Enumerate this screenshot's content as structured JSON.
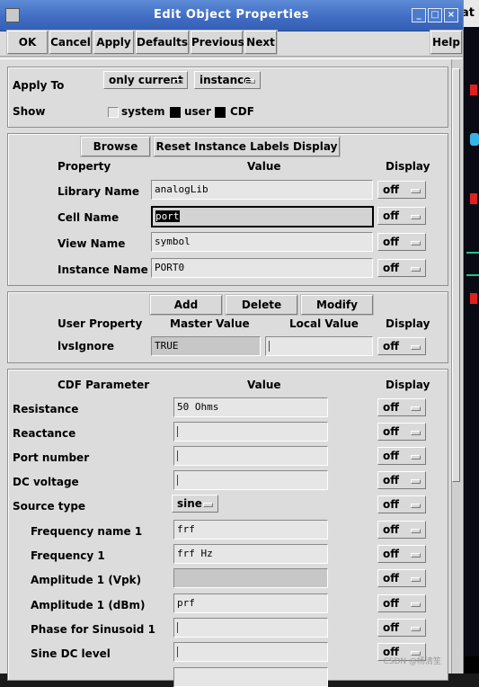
{
  "window": {
    "title": "Edit Object Properties",
    "min_glyph": "_",
    "max_glyph": "□",
    "close_glyph": "×"
  },
  "background_window": {
    "caption": "at"
  },
  "toolbar": {
    "ok": "OK",
    "cancel": "Cancel",
    "apply": "Apply",
    "defaults": "Defaults",
    "previous": "Previous",
    "next": "Next",
    "help": "Help"
  },
  "apply_section": {
    "apply_to_label": "Apply To",
    "apply_to_value": "only current",
    "target_value": "instance",
    "show_label": "Show",
    "show_options": [
      {
        "label": "system",
        "checked": false
      },
      {
        "label": "user",
        "checked": true
      },
      {
        "label": "CDF",
        "checked": true
      }
    ]
  },
  "instance_section": {
    "browse": "Browse",
    "reset": "Reset Instance Labels Display",
    "headers": {
      "property": "Property",
      "value": "Value",
      "display": "Display"
    },
    "rows": [
      {
        "label": "Library Name",
        "value": "analogLib",
        "display": "off"
      },
      {
        "label": "Cell Name",
        "value": "port",
        "display": "off"
      },
      {
        "label": "View Name",
        "value": "symbol",
        "display": "off"
      },
      {
        "label": "Instance Name",
        "value": "PORT0",
        "display": "off"
      }
    ]
  },
  "user_section": {
    "add": "Add",
    "delete": "Delete",
    "modify": "Modify",
    "headers": {
      "user_property": "User Property",
      "master_value": "Master Value",
      "local_value": "Local Value",
      "display": "Display"
    },
    "row": {
      "label": "lvsIgnore",
      "master": "TRUE",
      "local": "",
      "display": "off"
    }
  },
  "cdf_section": {
    "headers": {
      "parameter": "CDF Parameter",
      "value": "Value",
      "display": "Display"
    },
    "rows": [
      {
        "label": "Resistance",
        "value": "50 Ohms",
        "display": "off"
      },
      {
        "label": "Reactance",
        "value": "",
        "display": "off"
      },
      {
        "label": "Port number",
        "value": "",
        "display": "off"
      },
      {
        "label": "DC voltage",
        "value": "",
        "display": "off"
      },
      {
        "label": "Source type",
        "value": "sine",
        "display": "off"
      },
      {
        "label": "Frequency name 1",
        "value": "frf",
        "display": "off"
      },
      {
        "label": "Frequency 1",
        "value": "frf Hz",
        "display": "off"
      },
      {
        "label": "Amplitude 1 (Vpk)",
        "value": "",
        "display": "off"
      },
      {
        "label": "Amplitude 1 (dBm)",
        "value": "prf",
        "display": "off"
      },
      {
        "label": "Phase for Sinusoid 1",
        "value": "",
        "display": "off"
      },
      {
        "label": "Sine DC level",
        "value": "",
        "display": "off"
      }
    ]
  },
  "watermark": "CSDN @杨清笙"
}
